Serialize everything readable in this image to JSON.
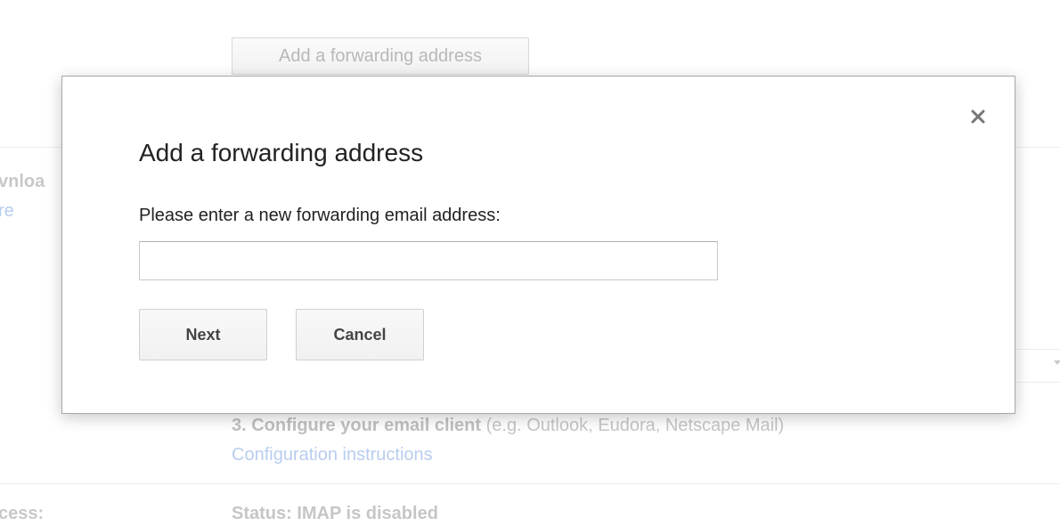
{
  "background": {
    "forwarding_button_label": "Add a forwarding address",
    "left_labels": [
      "vnloa",
      "re",
      "cess:"
    ],
    "step3_bold": "3. Configure your email client",
    "step3_rest": " (e.g. Outlook, Eudora, Netscape Mail)",
    "config_link": "Configuration instructions",
    "imap_status": "Status: IMAP is disabled"
  },
  "dialog": {
    "title": "Add a forwarding address",
    "prompt": "Please enter a new forwarding email address:",
    "email_input": {
      "value": "",
      "placeholder": ""
    },
    "next_label": "Next",
    "cancel_label": "Cancel",
    "close_icon": "close-icon"
  },
  "colors": {
    "link_faded": "#b9cdef",
    "text_faded": "#c6c6c6",
    "dialog_border": "#a8a8a8"
  }
}
